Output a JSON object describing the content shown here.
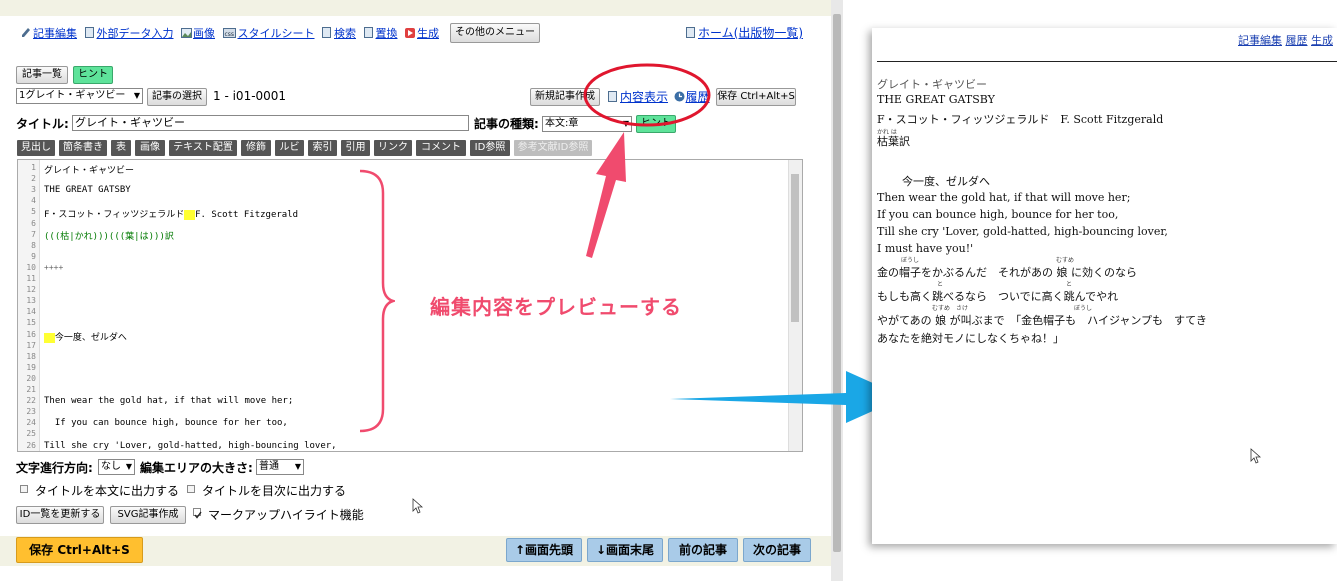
{
  "toolbar_links": [
    {
      "label": "記事編集",
      "icon": "pencil-icon"
    },
    {
      "label": "外部データ入力",
      "icon": "document-icon"
    },
    {
      "label": "画像",
      "icon": "image-icon"
    },
    {
      "label": "スタイルシート",
      "icon": "css-icon"
    },
    {
      "label": "検索",
      "icon": "document-icon"
    },
    {
      "label": "置換",
      "icon": "document-icon"
    },
    {
      "label": "生成",
      "icon": "generate-icon"
    }
  ],
  "other_menu": "その他のメニュー",
  "home_link": "ホーム(出版物一覧)",
  "article_list": "記事一覧",
  "hint": "ヒント",
  "article_select_value": "1グレイト・ギャツビー",
  "select_article_button": "記事の選択",
  "article_id": "1 - i01-0001",
  "new_article": "新規記事作成",
  "content_view": "内容表示",
  "history": "履歴",
  "save_top": "保存 Ctrl+Alt+S",
  "title_label": "タイトル:",
  "title_value": "グレイト・ギャツビー",
  "type_label": "記事の種類:",
  "type_value": "本文:章",
  "format_buttons": [
    "見出し",
    "箇条書き",
    "表",
    "画像",
    "テキスト配置",
    "修飾",
    "ルビ",
    "索引",
    "引用",
    "リンク",
    "コメント",
    "ID参照",
    "参考文献ID参照"
  ],
  "editor_lines": {
    "l1": "グレイト・ギャツビー",
    "l3": "THE GREAT GATSBY",
    "l5a": "F・スコット・フィッツジェラルド",
    "l5b": "F. Scott Fitzgerald",
    "l7": "(((枯|かれ)))(((葉|は)))訳",
    "l10": "++++",
    "l16": "今一度、ゼルダへ",
    "l22": "Then wear the gold hat, if that will move her;",
    "l24": "  If you can bounce high, bounce for her too,",
    "l26": "Till she cry 'Lover, gold-hatted, high-bouncing lover,"
  },
  "line_numbers": [
    "1",
    "2",
    "3",
    "4",
    "5",
    "6",
    "7",
    "8",
    "9",
    "10",
    "11",
    "12",
    "13",
    "14",
    "15",
    "16",
    "17",
    "18",
    "19",
    "20",
    "21",
    "22",
    "23",
    "24",
    "25",
    "26"
  ],
  "direction_label": "文字進行方向:",
  "direction_value": "なし",
  "area_size_label": "編集エリアの大きさ:",
  "area_size_value": "普通",
  "opt_title_body": "タイトルを本文に出力する",
  "opt_title_toc": "タイトルを目次に出力する",
  "update_id_list": "ID一覧を更新する",
  "svg_create": "SVG記事作成",
  "markup_highlight": "マークアップハイライト機能",
  "save_bottom": "保存 Ctrl+Alt+S",
  "nav": {
    "top": "↑画面先頭",
    "bottom": "↓画面末尾",
    "prev": "前の記事",
    "next": "次の記事"
  },
  "annotation": "編集内容をプレビューする",
  "preview": {
    "links": [
      "記事編集",
      "履歴",
      "生成"
    ],
    "lines": {
      "l1": "グレイト・ギャツビー",
      "l2": "THE GREAT GATSBY",
      "l3": "F・スコット・フィッツジェラルド　F. Scott Fitzgerald",
      "l4_ruby": "かれ は",
      "l4": "枯葉訳",
      "l5": "今一度、ゼルダへ",
      "l6": "Then wear the gold hat, if that will move her;",
      "l7": "If you can bounce high, bounce for her too,",
      "l8": "Till she cry 'Lover, gold-hatted, high-bouncing lover,",
      "l9": "I must have you!'",
      "l10": "金の帽子をかぶるんだ　それがあの 娘 に効くのなら",
      "l11": "もしも高く跳べるなら　ついでに高く跳んでやれ",
      "l12": "やがてあの 娘 が叫ぶまで　「金色帽子も　ハイジャンプも　すてき",
      "l13": "あなたを絶対モノにしなくちゃね！」"
    },
    "ruby": {
      "boushi": "ぼうし",
      "musume": "むすめ",
      "to": "と",
      "sakeb": "さけ"
    }
  },
  "colors": {
    "accent_green": "#5ee39a",
    "save_orange": "#ffbf2f",
    "nav_blue": "#a9cbe8",
    "annotation_red": "#f04b6e",
    "arrow_blue": "#1aa7e6"
  }
}
